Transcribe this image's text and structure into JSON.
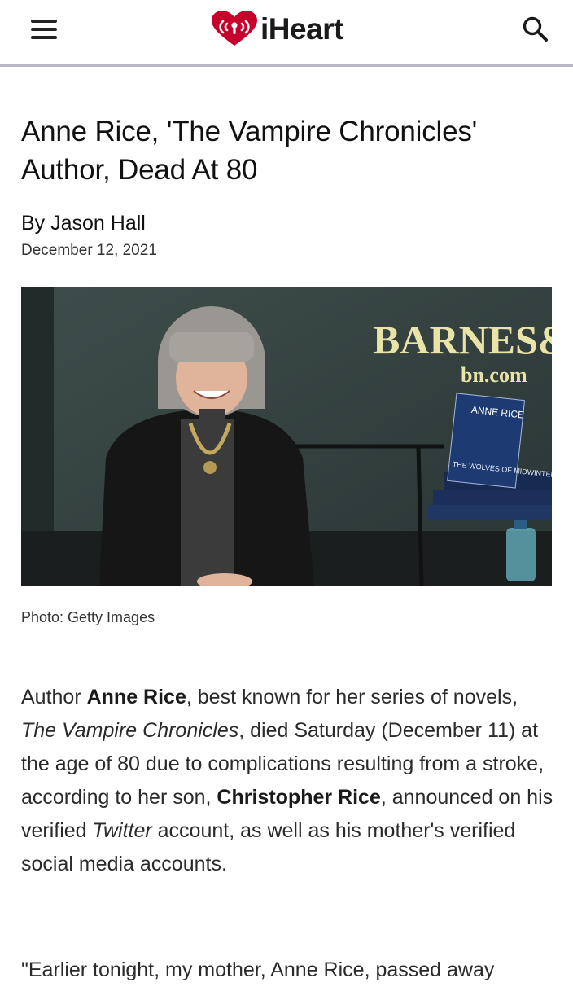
{
  "header": {
    "logo_text": "iHeart",
    "icons": {
      "menu": "hamburger-menu-icon",
      "search": "search-icon",
      "logo": "iheart-logo-icon"
    },
    "brand_color": "#c6002b"
  },
  "article": {
    "title": "Anne Rice, 'The Vampire Chronicles' Author, Dead At 80",
    "byline": "By Jason Hall",
    "date": "December 12, 2021",
    "image": {
      "sign_text": "BARNES&N",
      "sign_subtext": "bn.com",
      "book_author": "ANNE RICE",
      "book_title": "THE WOLVES OF MIDWINTER"
    },
    "caption": "Photo: Getty Images",
    "paragraph1": {
      "t1": "Author ",
      "b1": "Anne Rice",
      "t2": ", best known for her series of novels, ",
      "i1": "The Vampire Chronicles",
      "t3": ", died Saturday (December 11) at the age of 80 due to complications resulting from a stroke, according to her son, ",
      "b2": "Christopher Rice",
      "t4": ", announced on his verified ",
      "i2": "Twitter",
      "t5": " account, as well as his mother's verified social media accounts."
    },
    "paragraph2_start": "\"Earlier tonight, my mother, Anne Rice, passed away"
  }
}
